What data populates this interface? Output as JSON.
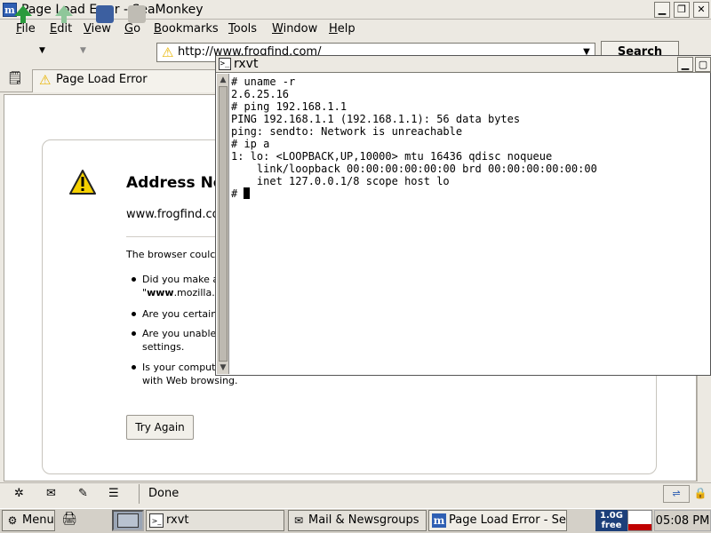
{
  "browser": {
    "title": "Page Load Error - SeaMonkey",
    "app_icon": "m",
    "menus": [
      "File",
      "Edit",
      "View",
      "Go",
      "Bookmarks",
      "Tools",
      "Window",
      "Help"
    ],
    "menu_mnemonics": [
      "F",
      "E",
      "V",
      "G",
      "B",
      "T",
      "W",
      "H"
    ],
    "url": "http://www.frogfind.com/",
    "search_label": "Search",
    "tab_label": "Page Load Error",
    "status": "Done"
  },
  "error_page": {
    "title": "Address No",
    "url": "www.frogfind.co",
    "description": "The browser coulc",
    "bullets": [
      [
        "Did you make a",
        "\"www.mozilla.c"
      ],
      [
        "Are you certain"
      ],
      [
        "Are you unable",
        "settings."
      ],
      [
        "Is your compute",
        "with Web browsing."
      ]
    ],
    "bullet_bold": "www",
    "try_again": "Try Again"
  },
  "terminal": {
    "title": "rxvt",
    "lines": [
      "# uname -r",
      "2.6.25.16",
      "# ping 192.168.1.1",
      "PING 192.168.1.1 (192.168.1.1): 56 data bytes",
      "ping: sendto: Network is unreachable",
      "# ip a",
      "1: lo: <LOOPBACK,UP,10000> mtu 16436 qdisc noqueue",
      "    link/loopback 00:00:00:00:00:00 brd 00:00:00:00:00:00",
      "    inet 127.0.0.1/8 scope host lo"
    ],
    "prompt": "# "
  },
  "taskbar": {
    "menu_label": "Menu",
    "tasks": [
      "rxvt",
      "Mail & Newsgroups",
      "Page Load Error - Se"
    ],
    "memory_value": "1.0G",
    "memory_label": "free",
    "clock": "05:08 PM"
  },
  "colors": {
    "warning": "#e8b400",
    "accent": "#2f5fb3",
    "cpu": "#c00000"
  }
}
